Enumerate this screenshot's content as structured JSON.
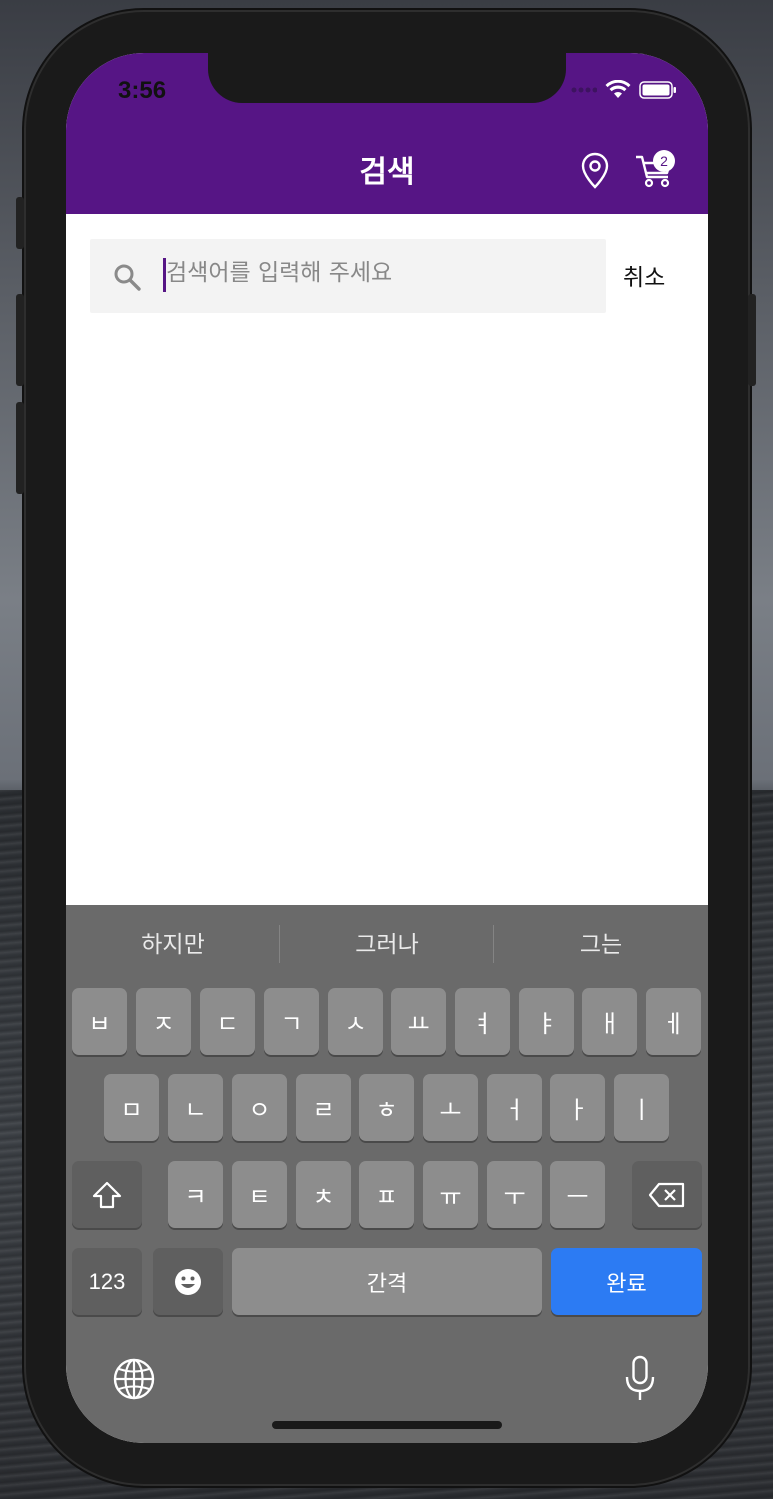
{
  "status_bar": {
    "time": "3:56"
  },
  "header": {
    "title": "검색",
    "cart_count": "2"
  },
  "search": {
    "placeholder": "검색어를 입력해 주세요",
    "value": "",
    "cancel_label": "취소"
  },
  "keyboard": {
    "suggestions": [
      "하지만",
      "그러나",
      "그는"
    ],
    "row1": [
      "ㅂ",
      "ㅈ",
      "ㄷ",
      "ㄱ",
      "ㅅ",
      "ㅛ",
      "ㅕ",
      "ㅑ",
      "ㅐ",
      "ㅔ"
    ],
    "row2": [
      "ㅁ",
      "ㄴ",
      "ㅇ",
      "ㄹ",
      "ㅎ",
      "ㅗ",
      "ㅓ",
      "ㅏ",
      "ㅣ"
    ],
    "row3": [
      "ㅋ",
      "ㅌ",
      "ㅊ",
      "ㅍ",
      "ㅠ",
      "ㅜ",
      "ㅡ"
    ],
    "numbers_label": "123",
    "space_label": "간격",
    "done_label": "완료"
  },
  "colors": {
    "brand": "#561585",
    "done_key": "#2c7bf3"
  }
}
